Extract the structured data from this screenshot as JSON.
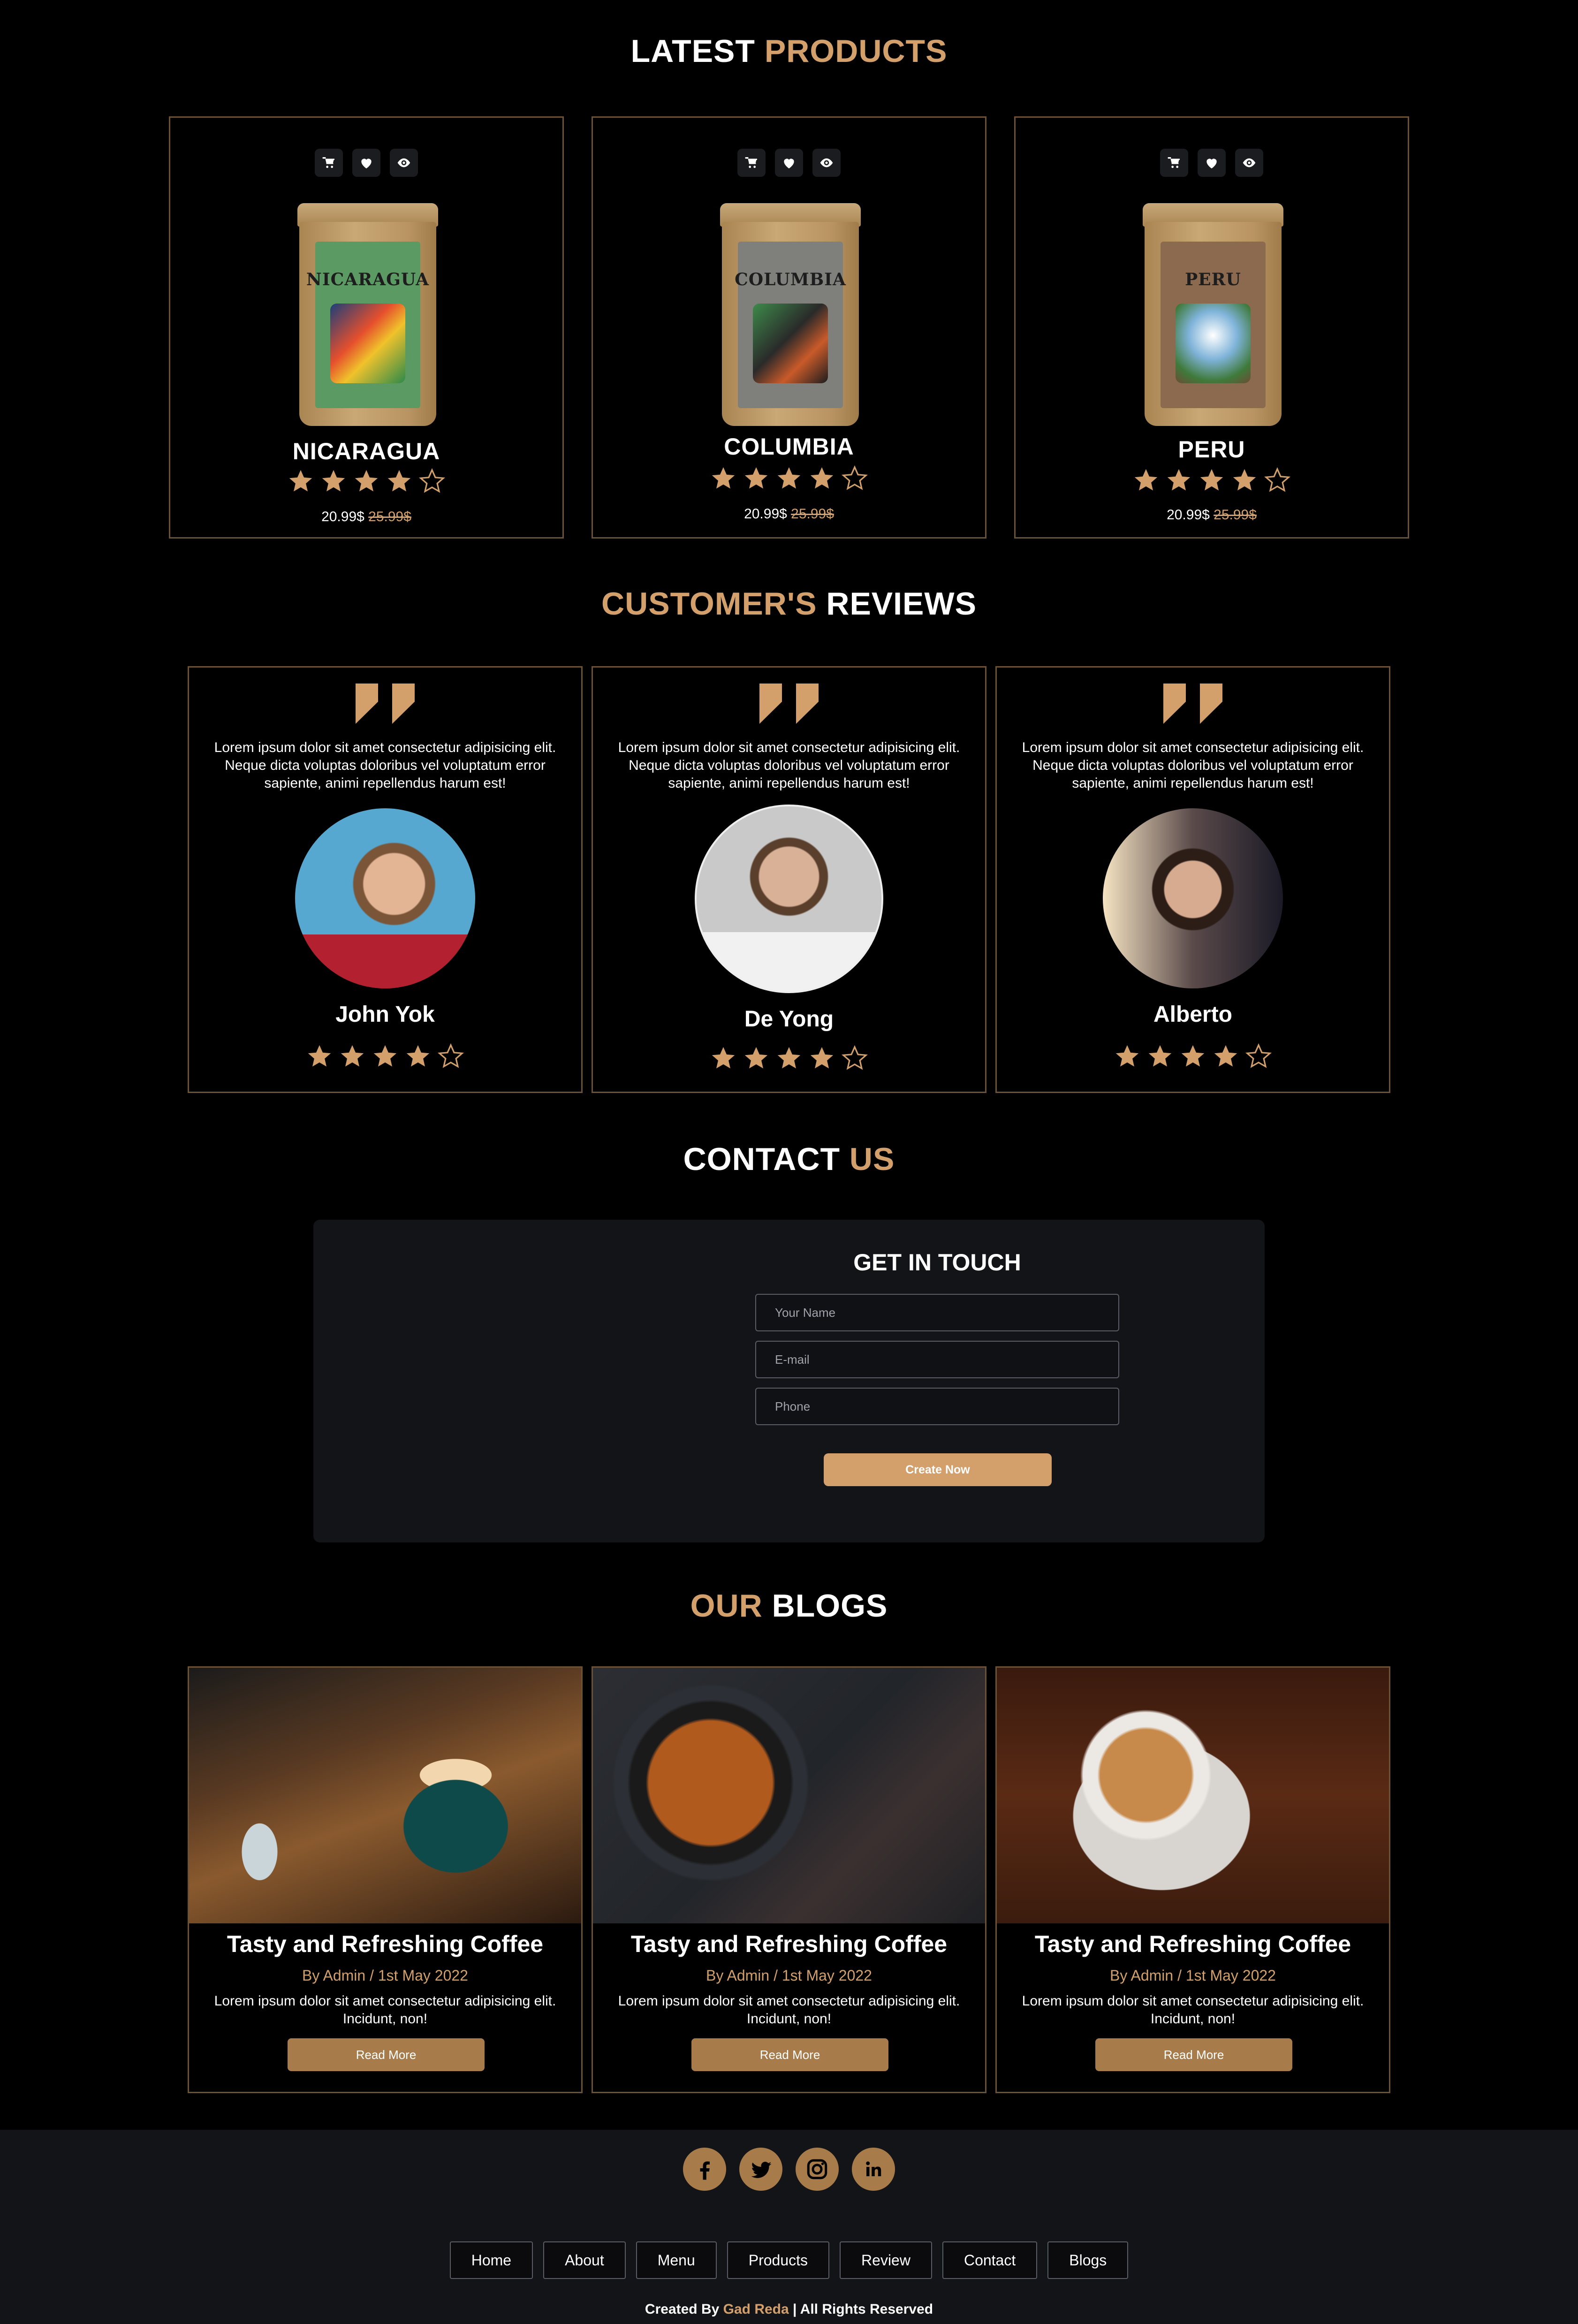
{
  "products_section": {
    "title_part1": "LATEST",
    "title_part2": "PRODUCTS",
    "items": [
      {
        "name": "NICARAGUA",
        "label": "NICARAGUA",
        "price": "20.99$",
        "old_price": "25.99$",
        "rating": 4,
        "bag_color": "#5b9a63"
      },
      {
        "name": "COLUMBIA",
        "label": "COLUMBIA",
        "price": "20.99$",
        "old_price": "25.99$",
        "rating": 4,
        "bag_color": "#7f7f7c"
      },
      {
        "name": "PERU",
        "label": "PERU",
        "price": "20.99$",
        "old_price": "25.99$",
        "rating": 4,
        "bag_color": "#8c6a50"
      }
    ],
    "action_icons": [
      "cart-icon",
      "heart-icon",
      "eye-icon"
    ]
  },
  "reviews_section": {
    "title_part1": "CUSTOMER'S",
    "title_part2": "REVIEWS",
    "items": [
      {
        "text": "Lorem ipsum dolor sit amet consectetur adipisicing elit. Neque dicta voluptas doloribus vel voluptatum error sapiente, animi repellendus harum est!",
        "name": "John Yok",
        "rating": 4
      },
      {
        "text": "Lorem ipsum dolor sit amet consectetur adipisicing elit. Neque dicta voluptas doloribus vel voluptatum error sapiente, animi repellendus harum est!",
        "name": "De Yong",
        "rating": 4
      },
      {
        "text": "Lorem ipsum dolor sit amet consectetur adipisicing elit. Neque dicta voluptas doloribus vel voluptatum error sapiente, animi repellendus harum est!",
        "name": "Alberto",
        "rating": 4
      }
    ]
  },
  "contact_section": {
    "title_part1": "CONTACT",
    "title_part2": "US",
    "form_title": "GET IN TOUCH",
    "name_placeholder": "Your Name",
    "email_placeholder": "E-mail",
    "phone_placeholder": "Phone",
    "submit_label": "Create Now"
  },
  "blogs_section": {
    "title_part1": "OUR",
    "title_part2": "BLOGS",
    "items": [
      {
        "title": "Tasty and Refreshing Coffee",
        "meta": "By Admin / 1st May 2022",
        "text": "Lorem ipsum dolor sit amet consectetur adipisicing elit. Incidunt, non!",
        "button": "Read More"
      },
      {
        "title": "Tasty and Refreshing Coffee",
        "meta": "By Admin / 1st May 2022",
        "text": "Lorem ipsum dolor sit amet consectetur adipisicing elit. Incidunt, non!",
        "button": "Read More"
      },
      {
        "title": "Tasty and Refreshing Coffee",
        "meta": "By Admin / 1st May 2022",
        "text": "Lorem ipsum dolor sit amet consectetur adipisicing elit. Incidunt, non!",
        "button": "Read More"
      }
    ]
  },
  "footer": {
    "social": [
      "facebook-icon",
      "twitter-icon",
      "instagram-icon",
      "linkedin-icon"
    ],
    "nav": [
      "Home",
      "About",
      "Menu",
      "Products",
      "Review",
      "Contact",
      "Blogs"
    ],
    "credit_prefix": "Created By",
    "credit_name": "Gad Reda",
    "credit_suffix": "| All Rights Reserved"
  },
  "colors": {
    "accent": "#d3a06c",
    "border": "#6b5236",
    "panel": "#131418",
    "button": "#a87c4a"
  }
}
